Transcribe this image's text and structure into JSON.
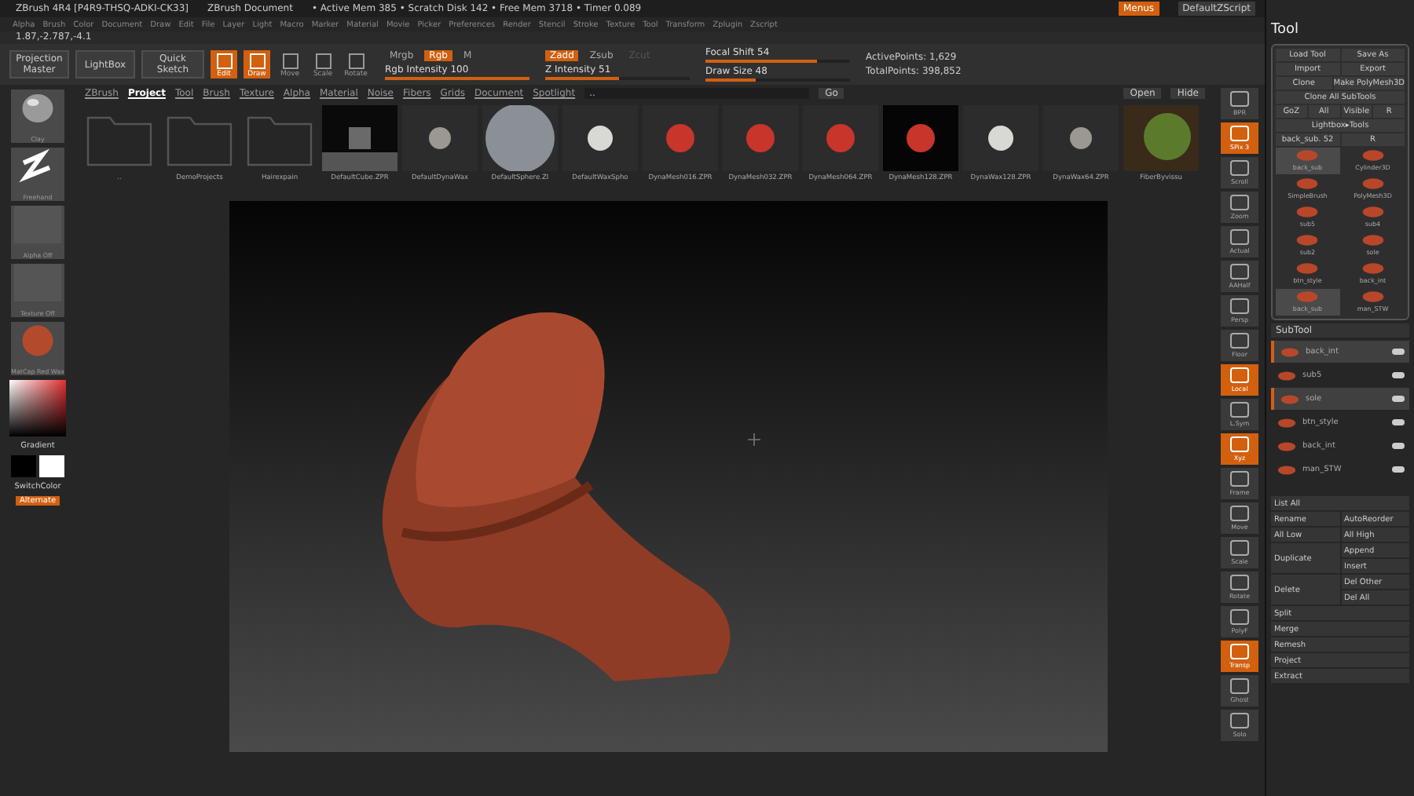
{
  "title_bar": {
    "app": "ZBrush 4R4 [P4R9-THSQ-ADKI-CK33]",
    "document": "ZBrush Document",
    "stats": "• Active Mem 385 • Scratch Disk 142 • Free Mem 3718 • Timer 0.089",
    "menus_button": "Menus",
    "script": "DefaultZScript"
  },
  "menu_bar": [
    "Alpha",
    "Brush",
    "Color",
    "Document",
    "Draw",
    "Edit",
    "File",
    "Layer",
    "Light",
    "Macro",
    "Marker",
    "Material",
    "Movie",
    "Picker",
    "Preferences",
    "Render",
    "Stencil",
    "Stroke",
    "Texture",
    "Tool",
    "Transform",
    "Zplugin",
    "Zscript"
  ],
  "coordinates": "1.87,-2.787,-4.1",
  "toolbar": {
    "buttons": [
      {
        "label": "Projection Master",
        "kind": "text"
      },
      {
        "label": "LightBox",
        "kind": "text"
      },
      {
        "label": "Quick Sketch",
        "kind": "sketch"
      }
    ],
    "modes": [
      {
        "label": "Edit",
        "on": true
      },
      {
        "label": "Draw",
        "on": true
      },
      {
        "label": "Move",
        "on": false
      },
      {
        "label": "Scale",
        "on": false
      },
      {
        "label": "Rotate",
        "on": false
      }
    ],
    "color_modes": [
      {
        "label": "Mrgb",
        "on": false
      },
      {
        "label": "Rgb",
        "on": true
      },
      {
        "label": "M",
        "on": false
      }
    ],
    "z_modes": [
      {
        "label": "Zadd",
        "on": true,
        "disabled": false
      },
      {
        "label": "Zsub",
        "on": false,
        "disabled": false
      },
      {
        "label": "Zcut",
        "on": false,
        "disabled": true
      }
    ],
    "sliders": [
      {
        "label": "Rgb Intensity 100",
        "level": 1.0
      },
      {
        "label": "Z Intensity 51",
        "level": 0.51
      },
      {
        "label": "Focal Shift 54",
        "level": 0.77
      },
      {
        "label": "Draw Size 48",
        "level": 0.35
      }
    ],
    "stats": [
      "ActivePoints: 1,629",
      "TotalPoints: 398,852"
    ]
  },
  "left_shelf": {
    "items": [
      {
        "label": "Clay",
        "kind": "brush"
      },
      {
        "label": "Freehand",
        "kind": "stroke"
      },
      {
        "label": "Alpha Off",
        "kind": "alpha"
      },
      {
        "label": "Texture Off",
        "kind": "texture"
      },
      {
        "label": "MatCap Red Wax",
        "kind": "material"
      }
    ],
    "gradient": "Gradient",
    "switch_color": "SwitchColor",
    "alternate": "Alternate"
  },
  "lightbox": {
    "tabs": [
      {
        "label": "ZBrush",
        "selected": false
      },
      {
        "label": "Project",
        "selected": true
      },
      {
        "label": "Tool",
        "selected": false
      },
      {
        "label": "Brush",
        "selected": false
      },
      {
        "label": "Texture",
        "selected": false
      },
      {
        "label": "Alpha",
        "selected": false
      },
      {
        "label": "Material",
        "selected": false
      },
      {
        "label": "Noise",
        "selected": false
      },
      {
        "label": "Fibers",
        "selected": false
      },
      {
        "label": "Grids",
        "selected": false
      },
      {
        "label": "Document",
        "selected": false
      },
      {
        "label": "Spotlight",
        "selected": false
      }
    ],
    "path": "..",
    "go": "Go",
    "open": "Open",
    "hide": "Hide",
    "items": [
      {
        "label": "..",
        "kind": "folder"
      },
      {
        "label": "DemoProjects",
        "kind": "folder"
      },
      {
        "label": "Hairexpain",
        "kind": "folder"
      },
      {
        "label": "DefaultCube.ZPR",
        "kind": "cube"
      },
      {
        "label": "DefaultDynaWax",
        "kind": "small-grey"
      },
      {
        "label": "DefaultSphere.ZI",
        "kind": "big-grey"
      },
      {
        "label": "DefaultWaxSpho",
        "kind": "small-white"
      },
      {
        "label": "DynaMesh016.ZPR",
        "kind": "red"
      },
      {
        "label": "DynaMesh032.ZPR",
        "kind": "red"
      },
      {
        "label": "DynaMesh064.ZPR",
        "kind": "red"
      },
      {
        "label": "DynaMesh128.ZPR",
        "kind": "red-dark"
      },
      {
        "label": "DynaWax128.ZPR",
        "kind": "small-white"
      },
      {
        "label": "DynaWax64.ZPR",
        "kind": "small-grey"
      },
      {
        "label": "FiberByvissu",
        "kind": "fiber"
      }
    ]
  },
  "right_shelf": [
    {
      "label": "BPR",
      "on": false
    },
    {
      "label": "SPix 3",
      "on": true
    },
    {
      "label": "Scroll",
      "on": false
    },
    {
      "label": "Zoom",
      "on": false
    },
    {
      "label": "Actual",
      "on": false
    },
    {
      "label": "AAHalf",
      "on": false
    },
    {
      "label": "Persp",
      "on": false
    },
    {
      "label": "Floor",
      "on": false
    },
    {
      "label": "Local",
      "on": true
    },
    {
      "label": "L.Sym",
      "on": false
    },
    {
      "label": "Xyz",
      "on": true
    },
    {
      "label": "Frame",
      "on": false
    },
    {
      "label": "Move",
      "on": false
    },
    {
      "label": "Scale",
      "on": false
    },
    {
      "label": "Rotate",
      "on": false
    },
    {
      "label": "PolyF",
      "on": false
    },
    {
      "label": "Transp",
      "on": true
    },
    {
      "label": "Ghost",
      "on": false
    },
    {
      "label": "Solo",
      "on": false
    }
  ],
  "tool_panel": {
    "title": "Tool",
    "button_rows": [
      [
        "Load Tool",
        "Save As"
      ],
      [
        "Import",
        "Export"
      ],
      [
        "Clone",
        "Make PolyMesh3D"
      ],
      [
        "Clone All SubTools"
      ],
      [
        "GoZ",
        "All",
        "Visible",
        "R"
      ],
      [
        "Lightbox▸Tools"
      ],
      [
        "back_sub. 52",
        "R"
      ]
    ],
    "tools": [
      {
        "label": "back_sub",
        "selected": true
      },
      {
        "label": "Cylinder3D",
        "selected": false
      },
      {
        "label": "SimpleBrush",
        "selected": false
      },
      {
        "label": "PolyMesh3D",
        "selected": false
      },
      {
        "label": "sub5",
        "selected": false
      },
      {
        "label": "sub4",
        "selected": false
      },
      {
        "label": "sub2",
        "selected": false
      },
      {
        "label": "sole",
        "selected": false
      },
      {
        "label": "btn_style",
        "selected": false
      },
      {
        "label": "back_int",
        "selected": false
      },
      {
        "label": "back_sub",
        "selected": true
      },
      {
        "label": "man_STW",
        "selected": false
      }
    ],
    "subtool_title": "SubTool",
    "subtools": [
      {
        "label": "back_int",
        "selected": true
      },
      {
        "label": "sub5",
        "selected": false
      },
      {
        "label": "sole",
        "selected": true
      },
      {
        "label": "btn_style",
        "selected": false
      },
      {
        "label": "back_int",
        "selected": false
      },
      {
        "label": "man_STW",
        "selected": false
      }
    ],
    "action_rows": [
      [
        "List All"
      ],
      [
        "Rename",
        "AutoReorder"
      ],
      [
        "All Low",
        "All High"
      ],
      [
        "Duplicate",
        "Append",
        "Insert"
      ],
      [
        "Delete",
        "Del Other",
        "Del All"
      ],
      [
        "Split"
      ],
      [
        "Merge"
      ],
      [
        "Remesh"
      ],
      [
        "Project"
      ],
      [
        "Extract"
      ]
    ]
  }
}
